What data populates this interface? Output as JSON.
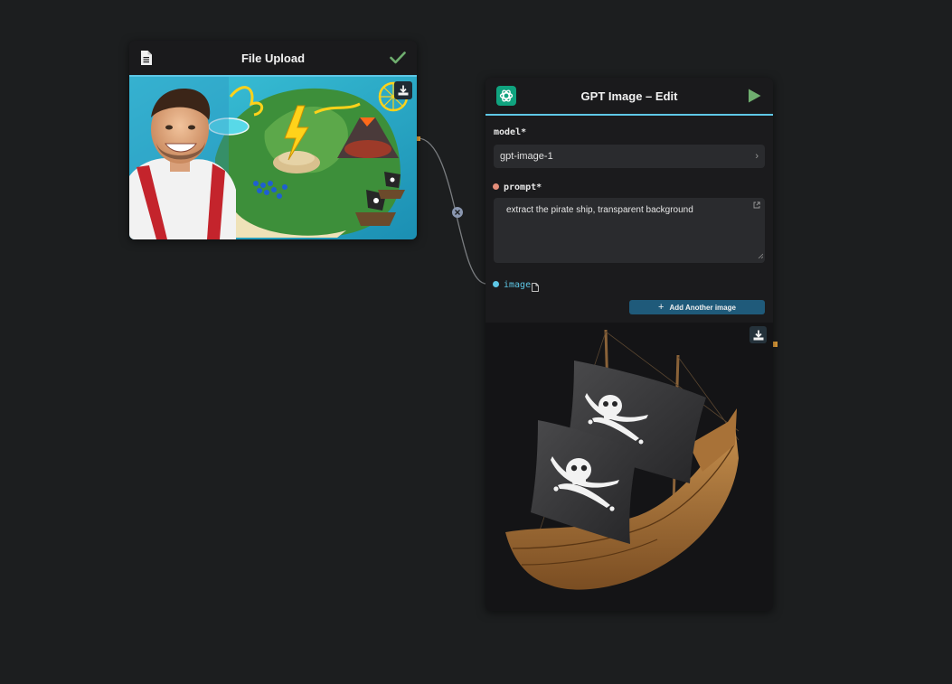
{
  "file_upload_node": {
    "title": "File Upload",
    "icons": {
      "file": "document-icon",
      "status": "check-icon",
      "download": "download-icon"
    }
  },
  "gpt_edit_node": {
    "title": "GPT Image – Edit",
    "icons": {
      "app": "openai-icon",
      "run": "play-icon",
      "download": "download-icon"
    },
    "model_label": "model*",
    "model_value": "gpt-image-1",
    "prompt_label": "prompt*",
    "prompt_value": "extract the pirate ship, transparent background",
    "image_label": "image",
    "add_image_label": "Add Another image"
  },
  "colors": {
    "canvas_bg": "#1c1e1f",
    "node_bg": "#1b1b1d",
    "accent": "#5ec7e6",
    "success": "#6fae6f",
    "button": "#1f5a7a",
    "prompt_dot": "#e58e7a",
    "image_dot": "#5ec7e6",
    "output_port": "#e6a23c"
  }
}
